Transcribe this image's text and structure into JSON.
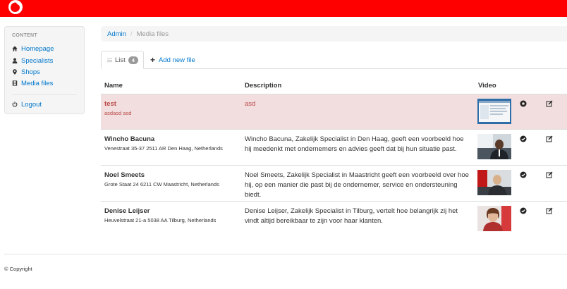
{
  "brand": {
    "color": "#ff0000",
    "logo_icon": "vodafone-logo"
  },
  "sidebar": {
    "header": "CONTENT",
    "items": [
      {
        "label": "Homepage",
        "icon": "home-icon"
      },
      {
        "label": "Specialists",
        "icon": "user-icon"
      },
      {
        "label": "Shops",
        "icon": "map-marker-icon"
      },
      {
        "label": "Media files",
        "icon": "film-icon"
      }
    ],
    "logout": {
      "label": "Logout",
      "icon": "power-icon"
    }
  },
  "breadcrumb": {
    "root": "Admin",
    "separator": "/",
    "current": "Media files"
  },
  "tabs": {
    "list_label": "List",
    "list_count": "4",
    "add_label": "Add new file"
  },
  "table": {
    "headers": {
      "name": "Name",
      "description": "Description",
      "video": "Video"
    },
    "rows": [
      {
        "name": "test",
        "sub": "asdasd asd",
        "description": "asd",
        "state": "error"
      },
      {
        "name": "Wincho Bacuna",
        "sub": "Venestraat 35-37 2511 AR Den Haag, Netherlands",
        "description": "Wincho Bacuna, Zakelijk Specialist in Den Haag, geeft een voorbeeld hoe hij meedenkt met ondernemers en advies geeft dat bij hun situatie past."
      },
      {
        "name": "Noel Smeets",
        "sub": "Grote Staat 24 6211 CW Maastricht, Netherlands",
        "description": "Noel Smeets, Zakelijk Specialist in Maastricht geeft een voorbeeld over hoe hij, op een manier die past bij de ondernemer, service en ondersteuning biedt."
      },
      {
        "name": "Denise Leijser",
        "sub": "Heuvelstraat 21-a 5038 AA Tilburg, Netherlands",
        "description": "Denise Leijser, Zakelijk Specialist in Tilburg, vertelt hoe belangrijk zij het vindt altijd bereikbaar te zijn voor haar klanten."
      }
    ]
  },
  "footer": {
    "copyright": "© Copyright"
  },
  "colors": {
    "link": "#0077cc",
    "error_bg": "#f2dede",
    "error_text": "#b94a48"
  }
}
